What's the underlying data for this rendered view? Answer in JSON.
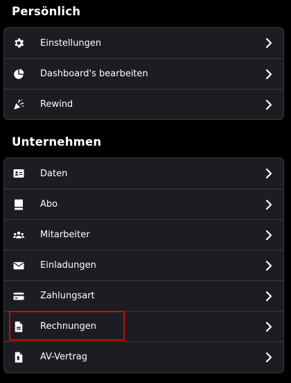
{
  "sections": {
    "personal": {
      "title": "Persönlich",
      "items": [
        {
          "label": "Einstellungen",
          "icon": "gear-icon"
        },
        {
          "label": "Dashboard's bearbeiten",
          "icon": "pie-chart-icon"
        },
        {
          "label": "Rewind",
          "icon": "party-popper-icon"
        }
      ]
    },
    "company": {
      "title": "Unternehmen",
      "items": [
        {
          "label": "Daten",
          "icon": "id-card-icon"
        },
        {
          "label": "Abo",
          "icon": "book-icon"
        },
        {
          "label": "Mitarbeiter",
          "icon": "users-icon"
        },
        {
          "label": "Einladungen",
          "icon": "envelope-icon"
        },
        {
          "label": "Zahlungsart",
          "icon": "credit-card-icon"
        },
        {
          "label": "Rechnungen",
          "icon": "invoice-icon"
        },
        {
          "label": "AV-Vertrag",
          "icon": "contract-icon"
        }
      ]
    }
  },
  "colors": {
    "background": "#000000",
    "card": "#1c1d21",
    "border": "#3a3b40",
    "highlight": "#e00000"
  }
}
